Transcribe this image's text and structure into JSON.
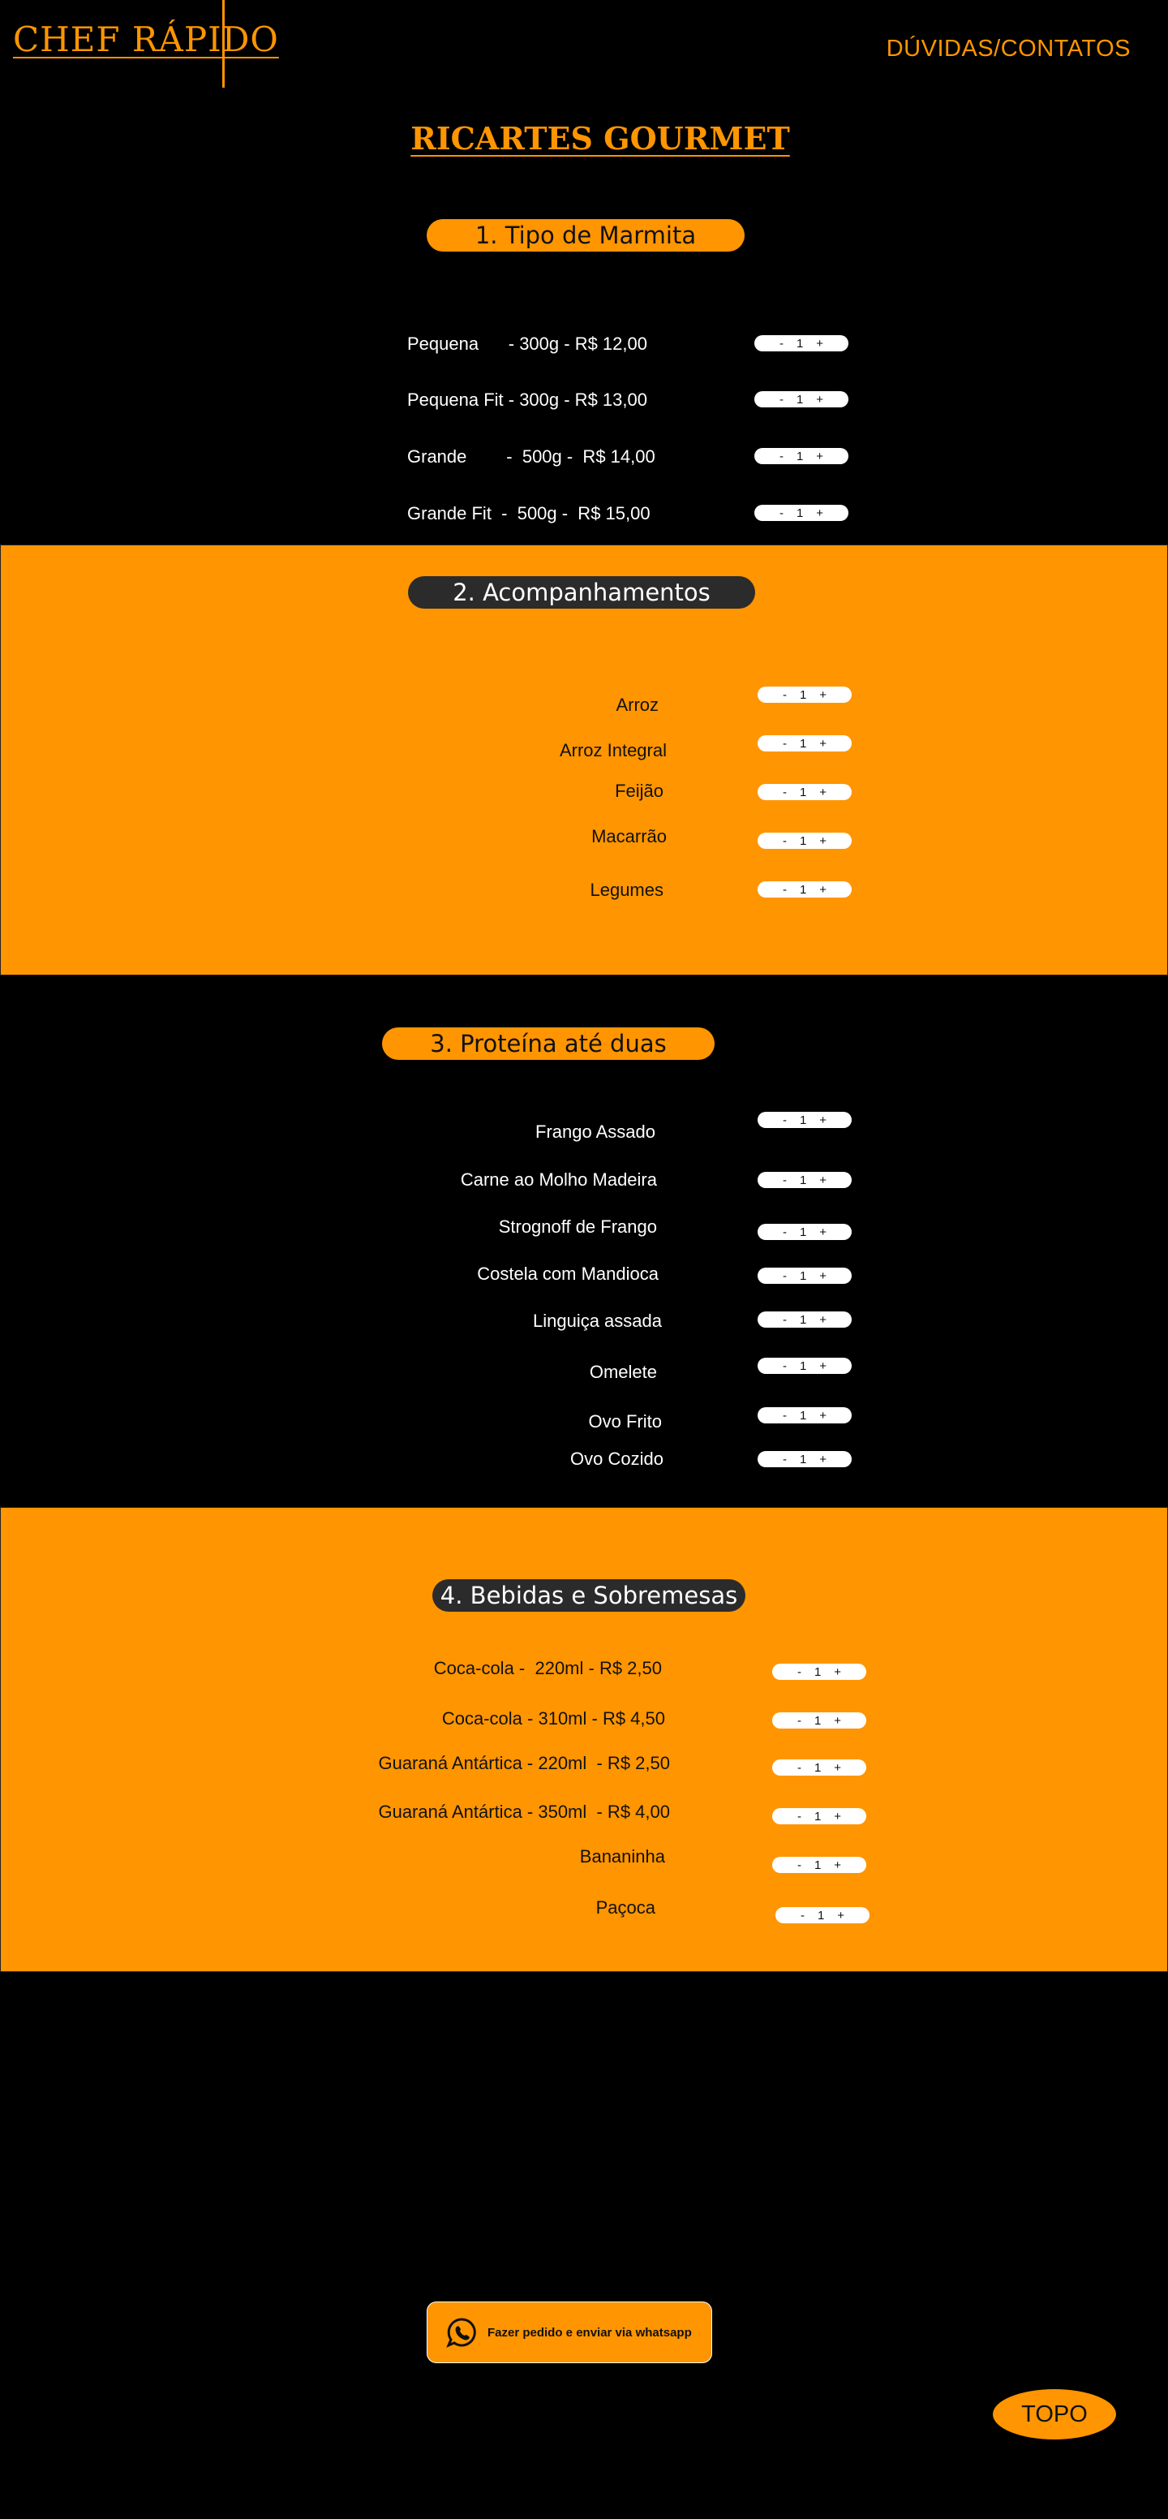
{
  "header": {
    "logo": "CHEF RÁPIDO",
    "nav_link": "DÚVIDAS/CONTATOS"
  },
  "page_title": "RICARTES GOURMET",
  "colors": {
    "accent": "#FF9500",
    "background": "#000000",
    "pill_dark": "#2B2B2B",
    "stepper_bg": "#FFFFFF"
  },
  "stepper": {
    "minus": "-",
    "plus": "+"
  },
  "sections": [
    {
      "title": "1. Tipo de Marmita",
      "items": [
        {
          "label": "Pequena      - 300g - R$ 12,00",
          "qty": "1"
        },
        {
          "label": "Pequena Fit - 300g - R$ 13,00",
          "qty": "1"
        },
        {
          "label": "Grande        -  500g -  R$ 14,00",
          "qty": "1"
        },
        {
          "label": "Grande Fit  -  500g -  R$ 15,00",
          "qty": "1"
        }
      ]
    },
    {
      "title": "2. Acompanhamentos",
      "items": [
        {
          "label": "Arroz",
          "qty": "1"
        },
        {
          "label": "Arroz Integral",
          "qty": "1"
        },
        {
          "label": "Feijão",
          "qty": "1"
        },
        {
          "label": "Macarrão",
          "qty": "1"
        },
        {
          "label": "Legumes",
          "qty": "1"
        }
      ]
    },
    {
      "title": "3. Proteína até duas",
      "items": [
        {
          "label": "Frango Assado",
          "qty": "1"
        },
        {
          "label": "Carne ao Molho Madeira",
          "qty": "1"
        },
        {
          "label": "Strognoff de Frango",
          "qty": "1"
        },
        {
          "label": "Costela com Mandioca",
          "qty": "1"
        },
        {
          "label": "Linguiça assada",
          "qty": "1"
        },
        {
          "label": "Omelete",
          "qty": "1"
        },
        {
          "label": "Ovo Frito",
          "qty": "1"
        },
        {
          "label": "Ovo Cozido",
          "qty": "1"
        }
      ]
    },
    {
      "title": "4. Bebidas e Sobremesas",
      "items": [
        {
          "label": "Coca-cola -  220ml - R$ 2,50",
          "qty": "1"
        },
        {
          "label": "Coca-cola - 310ml - R$ 4,50",
          "qty": "1"
        },
        {
          "label": "Guaraná Antártica - 220ml  - R$ 2,50",
          "qty": "1"
        },
        {
          "label": "Guaraná Antártica - 350ml  - R$ 4,00",
          "qty": "1"
        },
        {
          "label": "Bananinha",
          "qty": "1"
        },
        {
          "label": "Paçoca",
          "qty": "1"
        }
      ]
    }
  ],
  "whatsapp_button": {
    "icon": "whatsapp-icon",
    "label": "Fazer pedido e enviar via whatsapp"
  },
  "top_button": "TOPO"
}
